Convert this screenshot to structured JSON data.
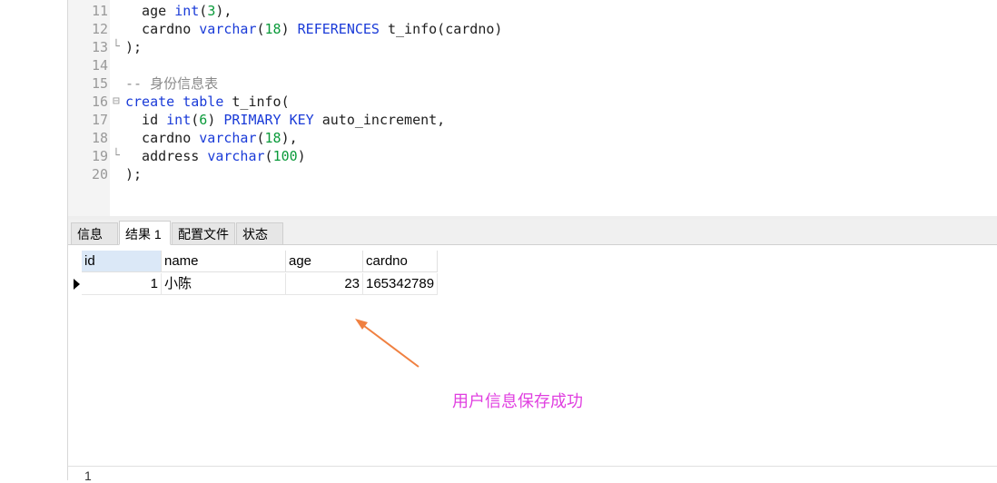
{
  "editor": {
    "lines": [
      {
        "n": "11",
        "fold": "",
        "parts": [
          [
            "  age ",
            ""
          ],
          [
            "int",
            "kw"
          ],
          [
            "(",
            ""
          ],
          [
            "3",
            "num"
          ],
          [
            "),",
            ""
          ]
        ]
      },
      {
        "n": "12",
        "fold": "",
        "parts": [
          [
            "  cardno ",
            ""
          ],
          [
            "varchar",
            "kw"
          ],
          [
            "(",
            ""
          ],
          [
            "18",
            "num"
          ],
          [
            ") ",
            ""
          ],
          [
            "REFERENCES",
            "kw"
          ],
          [
            " t_info(cardno)",
            ""
          ]
        ]
      },
      {
        "n": "13",
        "fold": "└",
        "parts": [
          [
            ");",
            ""
          ]
        ]
      },
      {
        "n": "14",
        "fold": "",
        "parts": []
      },
      {
        "n": "15",
        "fold": "",
        "parts": [
          [
            "-- 身份信息表",
            "cm"
          ]
        ]
      },
      {
        "n": "16",
        "fold": "⊟",
        "parts": [
          [
            "create",
            "kw"
          ],
          [
            " ",
            ""
          ],
          [
            "table",
            "kw"
          ],
          [
            " t_info(",
            ""
          ]
        ]
      },
      {
        "n": "17",
        "fold": "",
        "parts": [
          [
            "  id ",
            ""
          ],
          [
            "int",
            "kw"
          ],
          [
            "(",
            ""
          ],
          [
            "6",
            "num"
          ],
          [
            ") ",
            ""
          ],
          [
            "PRIMARY",
            "kw"
          ],
          [
            " ",
            ""
          ],
          [
            "KEY",
            "kw"
          ],
          [
            " auto_increment,",
            ""
          ]
        ]
      },
      {
        "n": "18",
        "fold": "",
        "parts": [
          [
            "  cardno ",
            ""
          ],
          [
            "varchar",
            "kw"
          ],
          [
            "(",
            ""
          ],
          [
            "18",
            "num"
          ],
          [
            "),",
            ""
          ]
        ]
      },
      {
        "n": "19",
        "fold": "└",
        "parts": [
          [
            "  address ",
            ""
          ],
          [
            "varchar",
            "kw"
          ],
          [
            "(",
            ""
          ],
          [
            "100",
            "num"
          ],
          [
            ")",
            ""
          ]
        ]
      },
      {
        "n": "20",
        "fold": "",
        "parts": [
          [
            ");",
            ""
          ]
        ]
      }
    ]
  },
  "tabs": [
    {
      "label": "信息",
      "active": false
    },
    {
      "label": "结果 1",
      "active": true
    },
    {
      "label": "配置文件",
      "active": false
    },
    {
      "label": "状态",
      "active": false
    }
  ],
  "grid": {
    "columns": [
      "id",
      "name",
      "age",
      "cardno"
    ],
    "rows": [
      [
        "1",
        "小陈",
        "23",
        "165342789"
      ]
    ]
  },
  "annotation": "用户信息保存成功",
  "status": {
    "line": "1"
  },
  "colors": {
    "keyword": "#1a3bd8",
    "number": "#0a9a3a",
    "comment": "#8a8a8a",
    "annotation": "#e040e0",
    "arrow": "#f08040"
  }
}
